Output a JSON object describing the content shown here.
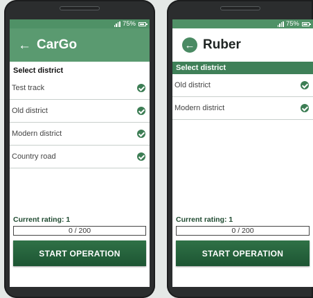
{
  "colors": {
    "accent": "#5a9a70",
    "header_dark": "#3f8058",
    "button": "#1d5533",
    "check": "#3c7d54"
  },
  "phones": [
    {
      "status": {
        "battery_text": "75%",
        "signal_icon": "signal-icon",
        "battery_icon": "battery-icon"
      },
      "app_bar": {
        "back_icon": "back-arrow-icon",
        "title": "CarGo"
      },
      "section_header": "Select district",
      "districts": [
        {
          "label": "Test track",
          "selected": true
        },
        {
          "label": "Old district",
          "selected": true
        },
        {
          "label": "Modern district",
          "selected": true
        },
        {
          "label": "Country road",
          "selected": true
        }
      ],
      "rating_label": "Current rating: 1",
      "progress": {
        "text": "0 / 200",
        "current": 0,
        "max": 200
      },
      "start_label": "START OPERATION"
    },
    {
      "status": {
        "battery_text": "75%",
        "signal_icon": "signal-icon",
        "battery_icon": "battery-icon"
      },
      "app_bar": {
        "back_icon": "back-circle-icon",
        "title": "Ruber"
      },
      "section_header": "Select district",
      "districts": [
        {
          "label": "Old district",
          "selected": true
        },
        {
          "label": "Modern district",
          "selected": true
        }
      ],
      "rating_label": "Current rating: 1",
      "progress": {
        "text": "0 / 200",
        "current": 0,
        "max": 200
      },
      "start_label": "START OPERATION"
    }
  ]
}
